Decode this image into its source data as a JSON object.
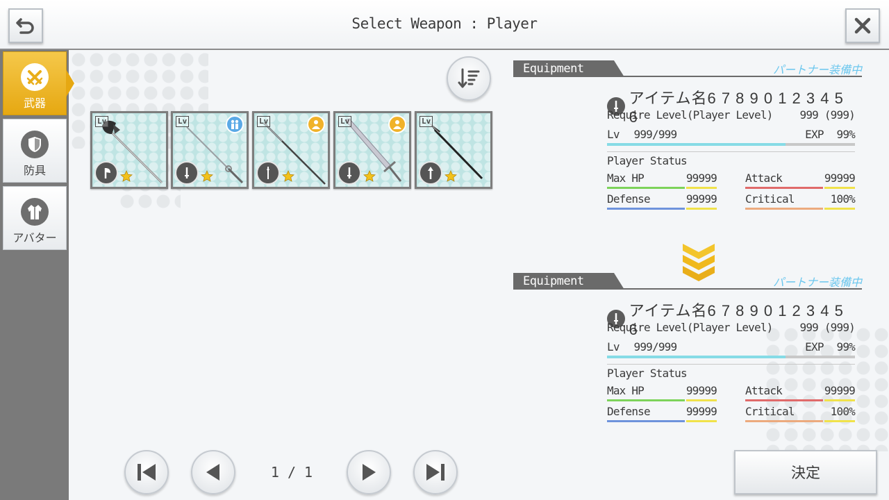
{
  "header": {
    "title": "Select Weapon : Player"
  },
  "sidebar": {
    "tabs": [
      {
        "label": "武器",
        "icon": "swords-icon",
        "active": true
      },
      {
        "label": "防具",
        "icon": "shield-icon",
        "active": false
      },
      {
        "label": "アバター",
        "icon": "coat-icon",
        "active": false
      }
    ]
  },
  "items": [
    {
      "lv": "Lv",
      "weapon": "axe",
      "type_icon": "axe-type-icon",
      "partner": null,
      "rarity": 1
    },
    {
      "lv": "Lv",
      "weapon": "rapier",
      "type_icon": "sword-type-icon",
      "partner": "partner-pair-icon",
      "rarity": 1
    },
    {
      "lv": "Lv",
      "weapon": "spear",
      "type_icon": "rapier-type-icon",
      "partner": "partner-single-icon",
      "rarity": 1
    },
    {
      "lv": "Lv",
      "weapon": "greatsword",
      "type_icon": "sword-type-icon",
      "partner": "partner-single-icon",
      "rarity": 1
    },
    {
      "lv": "Lv",
      "weapon": "lance",
      "type_icon": "spear-type-icon",
      "partner": null,
      "rarity": 1
    }
  ],
  "pager": {
    "page": "1 / 1"
  },
  "panels": [
    {
      "heading": "Equipment",
      "partner_note": "パートナー装備中",
      "item_name": "アイテム名6 7 8 9 0 1 2 3 4 5 6",
      "require_label": "Require Level(Player Level)",
      "require_value": "999 (999)",
      "lv_label": "Lv",
      "lv_value": "999/999",
      "exp_label": "EXP",
      "exp_value": "99%",
      "exp_fraction": 0.72,
      "status_title": "Player Status",
      "stats": [
        {
          "label": "Max HP",
          "value": "99999"
        },
        {
          "label": "Attack",
          "value": "99999"
        },
        {
          "label": "Defense",
          "value": "99999"
        },
        {
          "label": "Critical",
          "value": "100%"
        }
      ]
    },
    {
      "heading": "Equipment",
      "partner_note": "パートナー装備中",
      "item_name": "アイテム名6 7 8 9 0 1 2 3 4 5 6",
      "require_label": "Require Level(Player Level)",
      "require_value": "999 (999)",
      "lv_label": "Lv",
      "lv_value": "999/999",
      "exp_label": "EXP",
      "exp_value": "99%",
      "exp_fraction": 0.72,
      "status_title": "Player Status",
      "stats": [
        {
          "label": "Max HP",
          "value": "99999"
        },
        {
          "label": "Attack",
          "value": "99999"
        },
        {
          "label": "Defense",
          "value": "99999"
        },
        {
          "label": "Critical",
          "value": "100%"
        }
      ]
    }
  ],
  "confirm_label": "決定",
  "colors": {
    "accent_gold": "#e9ae1a",
    "partner_text": "#6cc7ee",
    "hp_bar": "#7dd35a",
    "attack_bar": "#e06a6a",
    "defense_bar": "#6e93dc",
    "critical_bar": "#ecaa7e",
    "stat_tail": "#f0e24a"
  }
}
